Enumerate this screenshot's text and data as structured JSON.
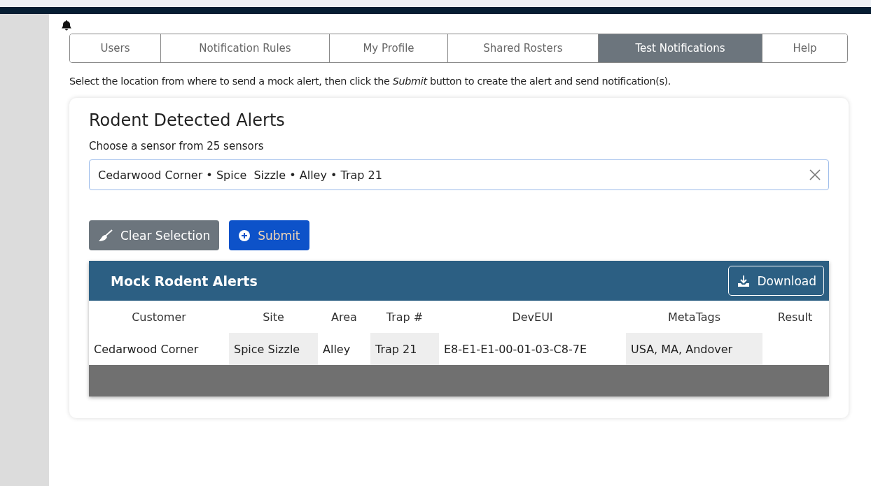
{
  "tabs": [
    {
      "label": "Users",
      "selected": false
    },
    {
      "label": "Notification Rules",
      "selected": false
    },
    {
      "label": "My Profile",
      "selected": false
    },
    {
      "label": "Shared Rosters",
      "selected": false
    },
    {
      "label": "Test Notifications",
      "selected": true
    },
    {
      "label": "Help",
      "selected": false
    }
  ],
  "instructions": "Select the location from where to send a mock alert, then click the *Submit* button to create the alert and send notification(s).",
  "card": {
    "title": "Rodent Detected Alerts",
    "field_label": "Choose a sensor from 25 sensors",
    "sensor_value": "Cedarwood Corner • Spice  Sizzle • Alley • Trap 21",
    "buttons": [
      {
        "label": "Clear Selection",
        "kind": "secondary"
      },
      {
        "label": "Submit",
        "kind": "primary"
      }
    ]
  },
  "table": {
    "title": "Mock Rodent Alerts",
    "download": "Download",
    "columns": [
      "Customer",
      "Site",
      "Area",
      "Trap #",
      "DevEUI",
      "MetaTags",
      "Result"
    ],
    "rows": [
      [
        "Cedarwood Corner",
        "Spice Sizzle",
        "Alley",
        "Trap 21",
        "E8-E1-E1-00-01-03-C8-7E",
        "USA, MA, Andover",
        ""
      ]
    ]
  }
}
